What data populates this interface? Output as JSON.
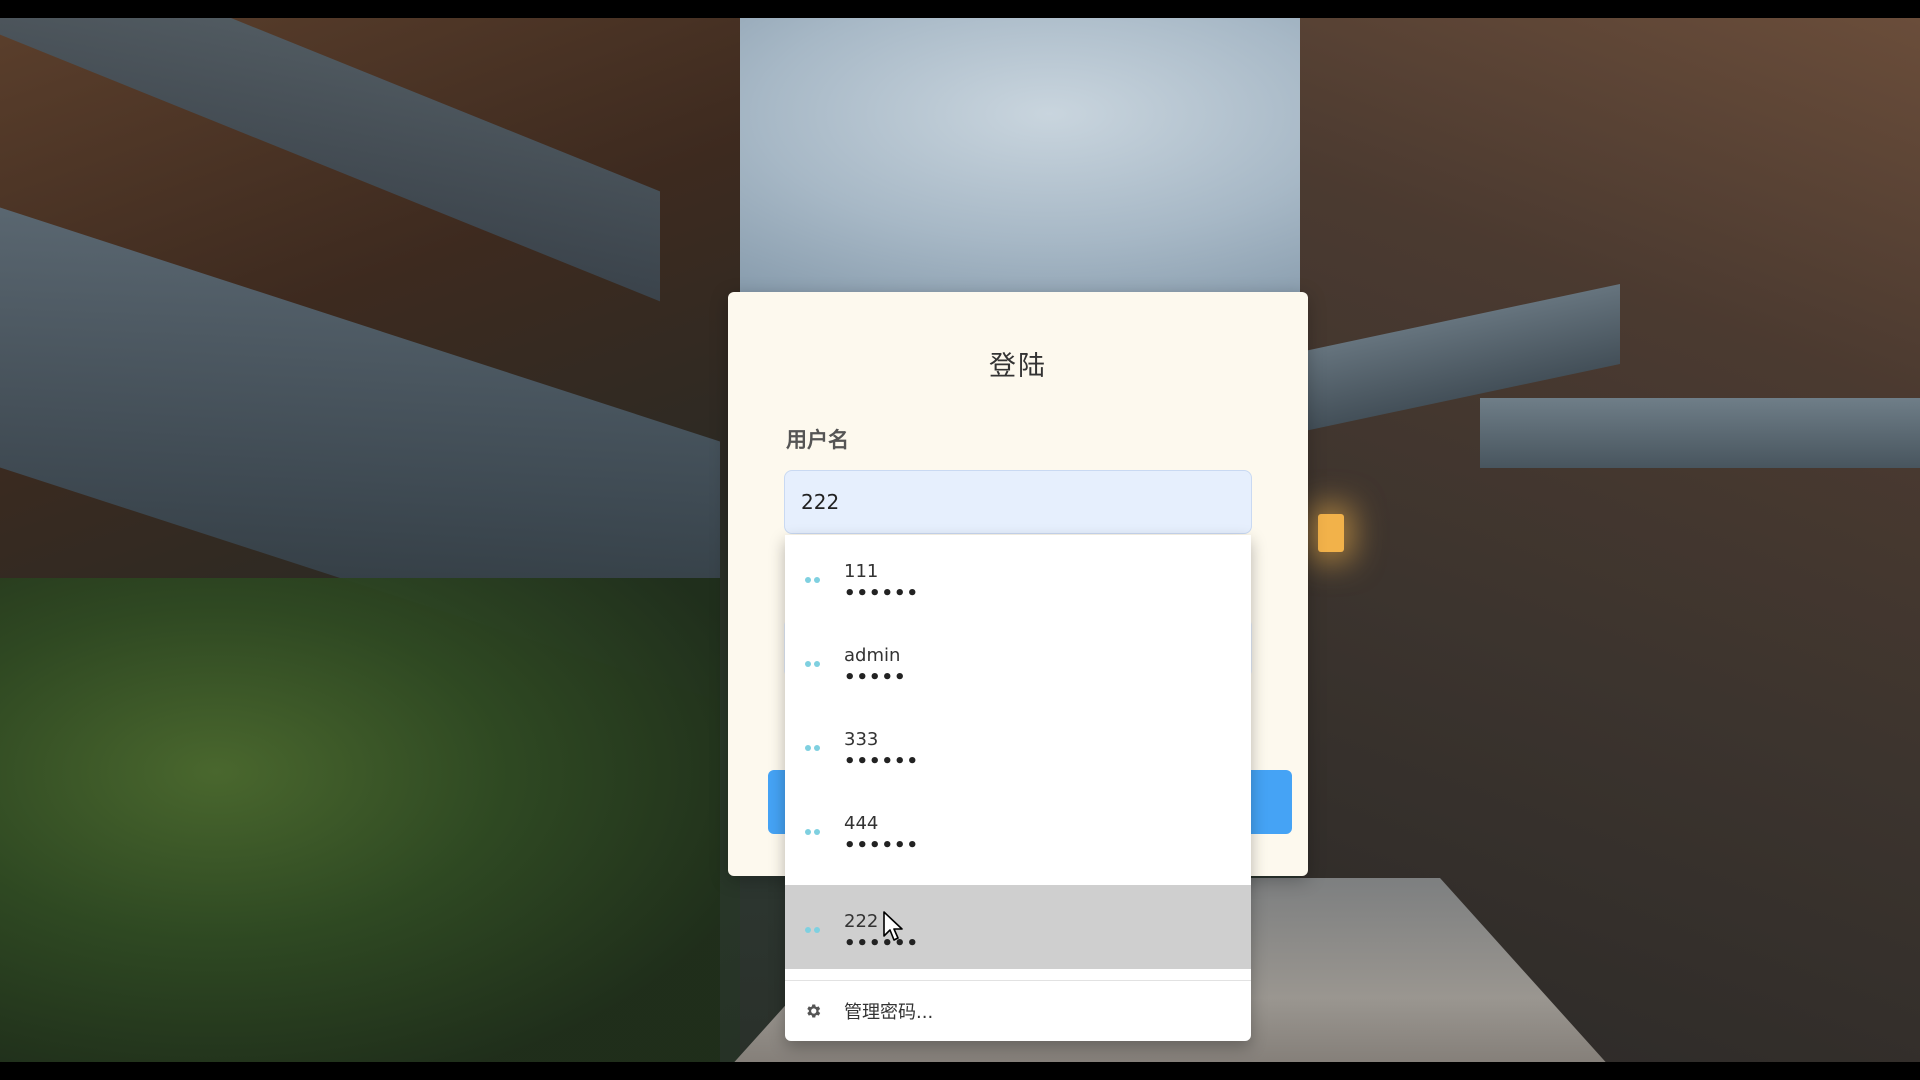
{
  "login": {
    "title": "登陆",
    "username_label": "用户名",
    "username_value": "222"
  },
  "autocomplete": {
    "options": [
      {
        "username": "111",
        "password_mask": "••••••"
      },
      {
        "username": "admin",
        "password_mask": "•••••"
      },
      {
        "username": "333",
        "password_mask": "••••••"
      },
      {
        "username": "444",
        "password_mask": "••••••"
      },
      {
        "username": "222",
        "password_mask": "••••••"
      }
    ],
    "selected_index": 4,
    "manage_label": "管理密码..."
  },
  "colors": {
    "card_background": "#fdf9ee",
    "input_background": "#e6effd",
    "button_blue": "#45a3f5",
    "key_icon": "#7fd0e0",
    "selected_row": "#cfcfcf"
  },
  "icons": {
    "option_icon": "key-icon",
    "manage_icon": "gear-icon"
  }
}
